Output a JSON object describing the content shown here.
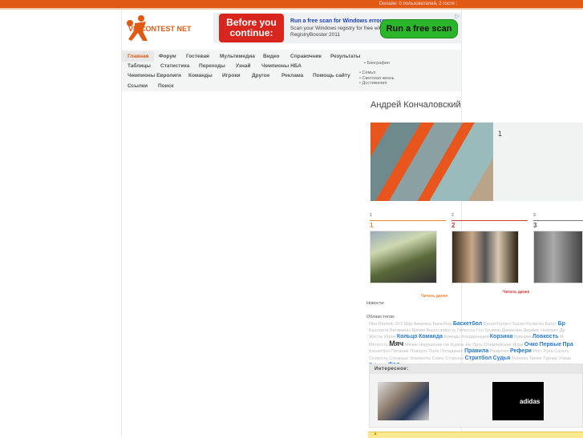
{
  "topbar": {
    "online": "Онлайн: 0 пользователей, 2 гостя :"
  },
  "logo": {
    "text": "VD CONTEST NET"
  },
  "ad": {
    "badge": "Before you continue:",
    "title": "Run a free scan for Windows errors",
    "text": "Scan your Windows registry for free with RegistryBooster 2011",
    "button": "Run a free scan"
  },
  "nav": {
    "row1": [
      "Главная",
      "Форум",
      "Гостевая",
      "Мультимедиа",
      "Видео",
      "Справочник",
      "Результаты"
    ],
    "row2": [
      "Таблицы",
      "Статистика",
      "Переходы",
      "Узнай",
      "Чемпионы НБА"
    ],
    "row3": [
      "Чемпионы Евролиги",
      "Команды",
      "Игроки",
      "Другое",
      "Реклама",
      "Помощь сайту"
    ],
    "row4": [
      "Ссылки",
      "Поиск"
    ]
  },
  "submenu": {
    "bio": "Биография",
    "items": [
      "Семья",
      "Светская жизнь",
      "Достижения"
    ]
  },
  "page": {
    "title": "Андрей Кончаловский",
    "hero_num": "1",
    "tabs": [
      {
        "small": "1",
        "big": "1",
        "color": "#e8862e"
      },
      {
        "small": "2",
        "big": "2",
        "color": "#d83a3a"
      },
      {
        "small": "3",
        "big": "3",
        "color": "#777777"
      }
    ],
    "read_more": "Читать далее",
    "news_label": "Новости:",
    "tags_label": "Облако тегов:"
  },
  "tags": [
    [
      [
        "Nba",
        0
      ],
      [
        "Reebok 3X3",
        0
      ],
      [
        "Skip",
        0
      ],
      [
        "Америка",
        0
      ],
      [
        "Бакетбол",
        0
      ],
      [
        "Баскетбол",
        1
      ],
      [
        "Баскетболист",
        0
      ],
      [
        "Баскетболисты",
        0
      ],
      [
        "Батут",
        0
      ],
      [
        "Бр",
        1
      ]
    ],
    [
      [
        "Быстрота",
        0
      ],
      [
        "Витамины",
        0
      ],
      [
        "Время",
        0
      ],
      [
        "Выносливость",
        0
      ],
      [
        "Гибкость",
        0
      ],
      [
        "Гол",
        0
      ],
      [
        "Грузики",
        0
      ],
      [
        "Движения",
        0
      ],
      [
        "Джеймс Нейсмит",
        0
      ],
      [
        "Др",
        0
      ]
    ],
    [
      [
        "Жесты",
        0
      ],
      [
        "Игрок",
        0
      ],
      [
        "Кольцо",
        1
      ],
      [
        "Команда",
        1
      ],
      [
        "Комнды",
        0
      ],
      [
        "Координация",
        0
      ],
      [
        "Корзина",
        1
      ],
      [
        "Кувырки",
        0
      ],
      [
        "Ловкость",
        1
      ],
      [
        "М",
        0
      ]
    ],
    [
      [
        "Меткость",
        0
      ],
      [
        "Мяч",
        2
      ],
      [
        "Мячик",
        0
      ],
      [
        "Нарушение",
        0
      ],
      [
        "Не Курить",
        0
      ],
      [
        "Не Пить",
        0
      ],
      [
        "Олимпийские Игры",
        0
      ],
      [
        "Очко",
        1
      ],
      [
        "Первые",
        1
      ],
      [
        "Пра",
        1
      ]
    ],
    [
      [
        "Баскетбол",
        0
      ],
      [
        "Питание",
        0
      ],
      [
        "Поворот",
        0
      ],
      [
        "Поле",
        0
      ],
      [
        "Попадание",
        0
      ],
      [
        "Правила",
        1
      ],
      [
        "Развитие",
        0
      ],
      [
        "Рефери",
        1
      ],
      [
        "Рост",
        0
      ],
      [
        "Рука",
        0
      ],
      [
        "Сальто",
        0
      ]
    ],
    [
      [
        "Скорость",
        0
      ],
      [
        "Сложные Элементы",
        0
      ],
      [
        "Спать",
        0
      ],
      [
        "Стороны",
        0
      ],
      [
        "Стритбол",
        1
      ],
      [
        "Судья",
        1
      ],
      [
        "Техника",
        0
      ],
      [
        "Трюки",
        0
      ],
      [
        "Турнир",
        0
      ],
      [
        "Улица",
        0
      ]
    ],
    [
      [
        "я",
        1
      ],
      [
        "Фенты",
        0
      ],
      [
        "Фол",
        1
      ]
    ]
  ],
  "interesting": {
    "title": "Интересное:"
  },
  "colors": {
    "accent": "#e05a14",
    "link": "#2a7ad6"
  }
}
